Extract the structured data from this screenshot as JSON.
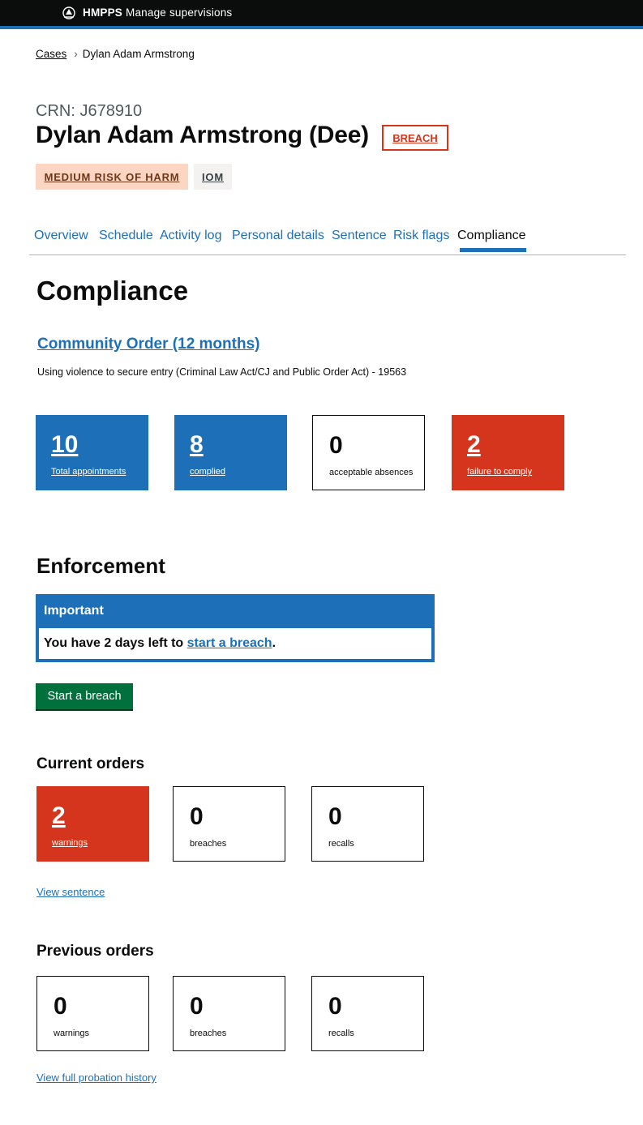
{
  "header": {
    "brand": "HMPPS",
    "service": "Manage supervisions",
    "crest_icon": "crest-icon"
  },
  "breadcrumb": {
    "cases": "Cases",
    "separator": "›",
    "current": "Dylan Adam Armstrong"
  },
  "person": {
    "crn": "CRN: J678910",
    "name": "Dylan Adam Armstrong (Dee)",
    "breach_tag": "BREACH",
    "risk_tag": "MEDIUM RISK OF HARM",
    "iom_tag": "IOM"
  },
  "tabs": [
    {
      "label": "Overview",
      "active": false
    },
    {
      "label": "Schedule",
      "active": false
    },
    {
      "label": "Activity log",
      "active": false
    },
    {
      "label": "Personal details",
      "active": false
    },
    {
      "label": "Sentence",
      "active": false
    },
    {
      "label": "Risk flags",
      "active": false
    },
    {
      "label": "Compliance",
      "active": true
    }
  ],
  "compliance": {
    "title": "Compliance",
    "sentence_link": "Community Order (12 months)",
    "offence": "Using violence to secure entry (Criminal Law Act/CJ and Public Order Act) - 19563",
    "stats": [
      {
        "value": "10",
        "label": "Total appointments",
        "style": "blue"
      },
      {
        "value": "8",
        "label": "complied",
        "style": "blue"
      },
      {
        "value": "0",
        "label": "acceptable absences",
        "style": "plain"
      },
      {
        "value": "2",
        "label": "failure to comply",
        "style": "red"
      }
    ]
  },
  "enforcement": {
    "title": "Enforcement",
    "banner_title": "Important",
    "banner_text_before": "You have 2 days left to ",
    "banner_link": "start a breach",
    "banner_text_after": ".",
    "button": "Start a breach"
  },
  "current_orders": {
    "title": "Current orders",
    "stats": [
      {
        "value": "2",
        "label": "warnings",
        "style": "red"
      },
      {
        "value": "0",
        "label": "breaches",
        "style": "plain"
      },
      {
        "value": "0",
        "label": "recalls",
        "style": "plain"
      }
    ],
    "link": "View sentence"
  },
  "previous_orders": {
    "title": "Previous orders",
    "stats": [
      {
        "value": "0",
        "label": "warnings",
        "style": "plain"
      },
      {
        "value": "0",
        "label": "breaches",
        "style": "plain"
      },
      {
        "value": "0",
        "label": "recalls",
        "style": "plain"
      }
    ],
    "link": "View full probation history"
  },
  "colors": {
    "brand_blue": "#1d70b8",
    "alert_red": "#d4351c",
    "button_green": "#00703c",
    "header_black": "#0b0c0c"
  }
}
